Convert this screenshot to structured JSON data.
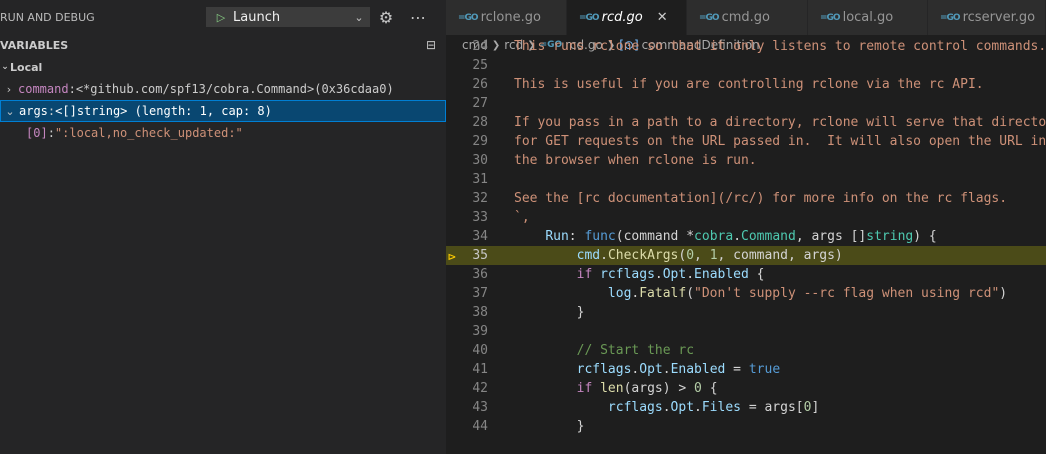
{
  "debug": {
    "title": "RUN AND DEBUG",
    "config": "Launch",
    "variables_title": "VARIABLES",
    "scope": "Local",
    "vars": [
      {
        "name": "command",
        "value": "<*github.com/spf13/cobra.Command>(0x36cdaa0)"
      },
      {
        "name": "args",
        "value": "<[]string> (length: 1, cap: 8)"
      },
      {
        "name": "[0]",
        "value": "\":local,no_check_updated:\""
      }
    ]
  },
  "tabs": [
    "rclone.go",
    "rcd.go",
    "cmd.go",
    "local.go",
    "rcserver.go"
  ],
  "breadcrumb": [
    "cmd",
    "rcd",
    "rcd.go",
    "commandDefinition"
  ],
  "lines": {
    "l24": "24",
    "l25": "25",
    "l26": "26",
    "l27": "27",
    "l28": "28",
    "l29": "29",
    "l30": "30",
    "l31": "31",
    "l32": "32",
    "l33": "33",
    "l34": "34",
    "l35": "35",
    "l36": "36",
    "l37": "37",
    "l38": "38",
    "l39": "39",
    "l40": "40",
    "l41": "41",
    "l42": "42",
    "l43": "43",
    "l44": "44"
  },
  "code": {
    "t24": "This runs rclone so that it only listens to remote control commands.",
    "t26": "This is useful if you are controlling rclone via the rc API.",
    "t28": "If you pass in a path to a directory, rclone will serve that directory",
    "t29": "for GET requests on the URL passed in.  It will also open the URL in",
    "t30": "the browser when rclone is run.",
    "t32": "See the [rc documentation](/rc/) for more info on the rc flags.",
    "t33": "`,",
    "t34a": "Run",
    "t34b": ": ",
    "t34c": "func",
    "t34d": "(command *",
    "t34e": "cobra",
    "t34f": ".",
    "t34g": "Command",
    "t34h": ", args []",
    "t34i": "string",
    "t34j": ") {",
    "t35a": "cmd",
    "t35b": ".",
    "t35c": "CheckArgs",
    "t35d": "(",
    "t35e": "0",
    "t35f": ", ",
    "t35g": "1",
    "t35h": ", command, args)",
    "t36a": "if",
    "t36b": " rcflags",
    "t36c": ".",
    "t36d": "Opt",
    "t36e": ".",
    "t36f": "Enabled",
    "t36g": " {",
    "t37a": "log",
    "t37b": ".",
    "t37c": "Fatalf",
    "t37d": "(",
    "t37e": "\"Don't supply --rc flag when using rcd\"",
    "t37f": ")",
    "t38": "}",
    "t40": "// Start the rc",
    "t41a": "rcflags",
    "t41b": ".",
    "t41c": "Opt",
    "t41d": ".",
    "t41e": "Enabled",
    "t41f": " = ",
    "t41g": "true",
    "t42a": "if",
    "t42b": " ",
    "t42c": "len",
    "t42d": "(args) > ",
    "t42e": "0",
    "t42f": " {",
    "t43a": "rcflags",
    "t43b": ".",
    "t43c": "Opt",
    "t43d": ".",
    "t43e": "Files",
    "t43f": " = args[",
    "t43g": "0",
    "t43h": "]",
    "t44": "}"
  }
}
